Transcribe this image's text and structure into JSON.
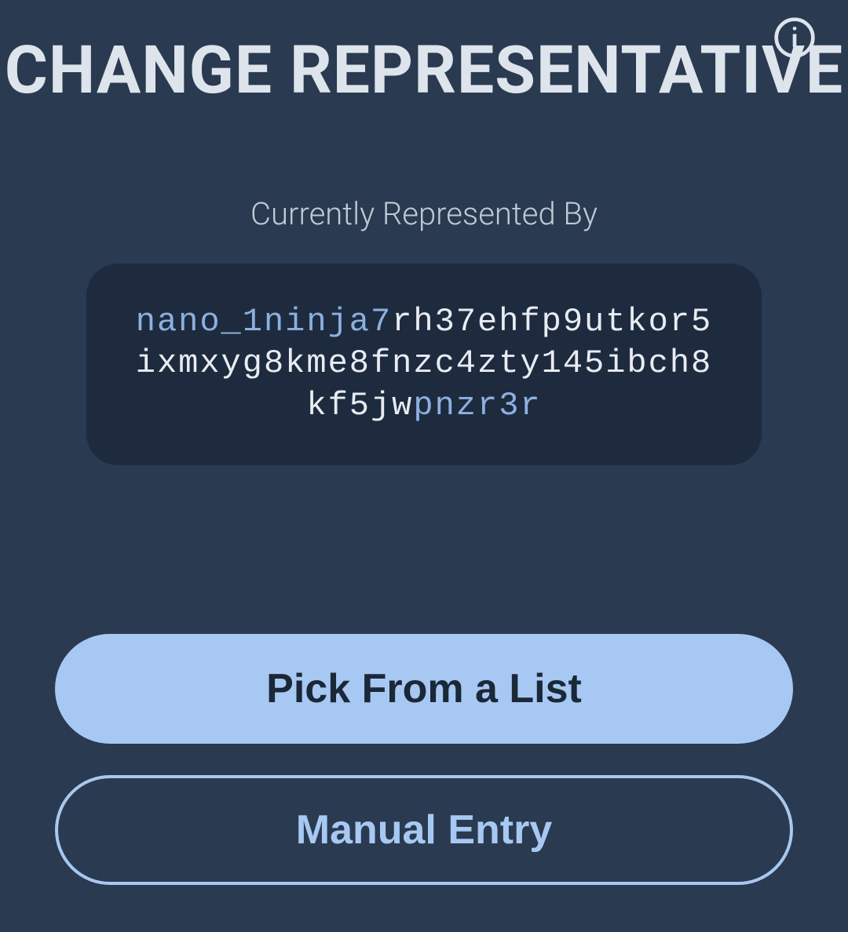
{
  "header": {
    "title": "CHANGE REPRESENTATIVE"
  },
  "content": {
    "subtitle": "Currently Represented By",
    "address": {
      "prefix": "nano_1ninja7",
      "middle": "rh37ehfp9utkor5ixmxyg8kme8fnzc4zty145ibch8kf5jw",
      "suffix": "pnzr3r"
    }
  },
  "buttons": {
    "pick_from_list": "Pick From a List",
    "manual_entry": "Manual Entry"
  },
  "icons": {
    "info": "info-icon"
  }
}
